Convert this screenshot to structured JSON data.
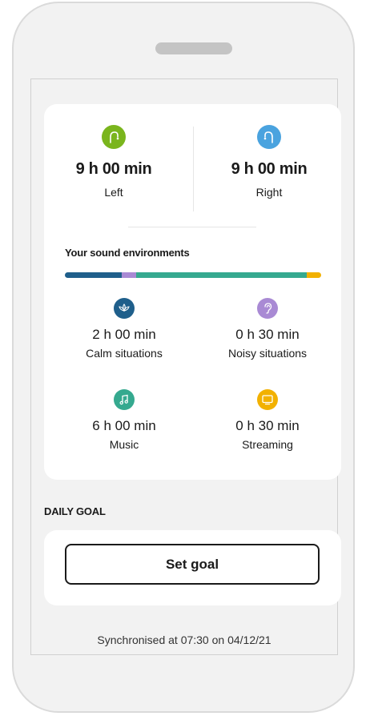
{
  "hearing_aids": {
    "left": {
      "time": "9 h 00 min",
      "label": "Left",
      "color": "#7ab51d",
      "icon": "left-hearing-aid-icon"
    },
    "right": {
      "time": "9 h 00 min",
      "label": "Right",
      "color": "#4aa3df",
      "icon": "right-hearing-aid-icon"
    }
  },
  "environments": {
    "title": "Your sound environments",
    "bar_segments": [
      {
        "name": "Calm situations",
        "fraction": 0.222,
        "color": "#1f5f8b"
      },
      {
        "name": "Noisy situations",
        "fraction": 0.056,
        "color": "#a98ad4"
      },
      {
        "name": "Music",
        "fraction": 0.667,
        "color": "#35a98f"
      },
      {
        "name": "Streaming",
        "fraction": 0.056,
        "color": "#f2b100"
      }
    ],
    "items": [
      {
        "time": "2 h 00 min",
        "label": "Calm situations",
        "color": "#1f5f8b",
        "icon": "lotus-icon"
      },
      {
        "time": "0 h 30 min",
        "label": "Noisy situations",
        "color": "#a98ad4",
        "icon": "ear-icon"
      },
      {
        "time": "6 h 00 min",
        "label": "Music",
        "color": "#35a98f",
        "icon": "music-note-icon"
      },
      {
        "time": "0 h 30 min",
        "label": "Streaming",
        "color": "#f2b100",
        "icon": "tv-icon"
      }
    ]
  },
  "daily_goal": {
    "title": "DAILY GOAL",
    "button_label": "Set goal"
  },
  "sync_text": "Synchronised at 07:30 on 04/12/21"
}
